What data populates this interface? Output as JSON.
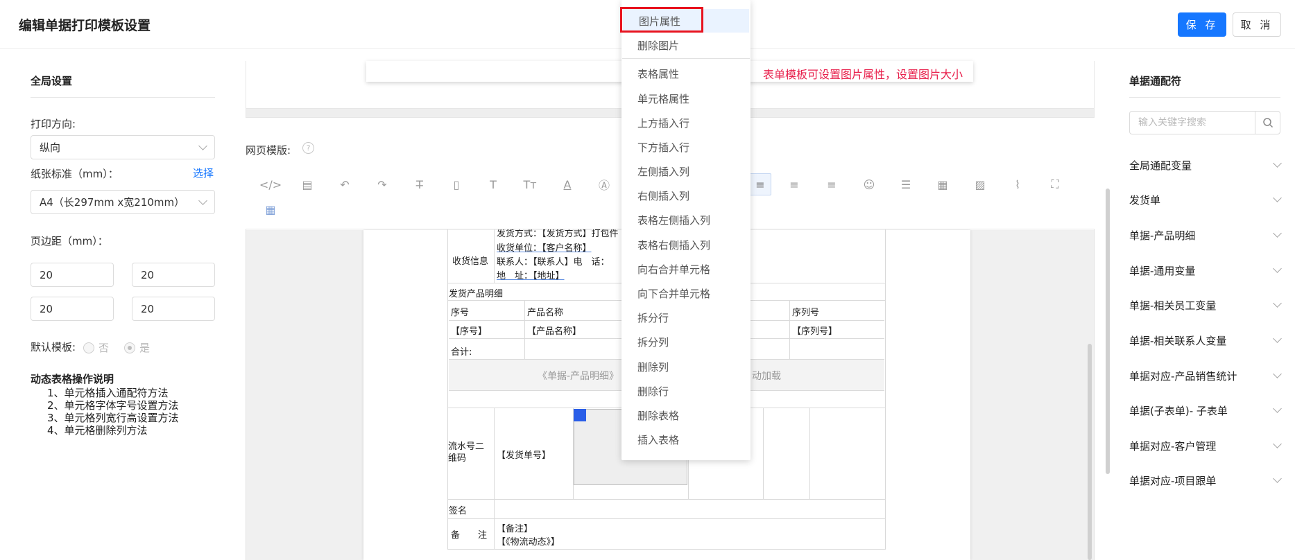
{
  "header": {
    "title": "编辑单据打印模板设置",
    "save_label": "保 存",
    "cancel_label": "取 消"
  },
  "global_settings": {
    "title": "全局设置",
    "orientation_label": "打印方向:",
    "orientation_value": "纵向",
    "paper_label": "纸张标准（mm）：",
    "paper_select_link": "选择",
    "paper_value": "A4（长297mm x宽210mm）",
    "margin_label": "页边距（mm）：",
    "margins": [
      "20",
      "20",
      "20",
      "20"
    ],
    "default_template_label": "默认模板:",
    "radio_no": "否",
    "radio_yes": "是",
    "default_template_value": "是"
  },
  "help": {
    "title": "动态表格操作说明",
    "items": [
      "1、单元格插入通配符方法",
      "2、单元格字体字号设置方法",
      "3、单元格列宽行高设置方法",
      "4、单元格删除列方法"
    ]
  },
  "center": {
    "annotation": "表单模板可设置图片属性，设置图片大小",
    "web_template_label": "网页模版:",
    "help_icon": "?"
  },
  "toolbar_icons": [
    "code-icon",
    "template-icon",
    "undo-icon",
    "redo-icon",
    "strikethrough-icon",
    "clear-format-icon",
    "font-icon",
    "font-size-icon",
    "font-color-icon",
    "bg-color-icon",
    "align-left-icon",
    "align-center-icon",
    "align-right-icon",
    "emoji-icon",
    "divider-icon",
    "table-icon",
    "image-icon",
    "attachment-icon",
    "fullscreen-icon",
    "table-grid-icon"
  ],
  "document": {
    "row1_label": "收货信息",
    "ship_method": "发货方式：【发货方式】打包件",
    "receiver_unit": "收货单位：【客户名称】",
    "contact": "联系人：【联系人】电　话：",
    "address": "地　址：【地址】",
    "product_section": "发货产品明细",
    "col_seq": "序号",
    "col_name": "产品名称",
    "col_serial": "序列号",
    "val_seq": "【序号】",
    "val_name": "【产品名称】",
    "val_serial": "【序列号】",
    "total": "合计:",
    "autoload_left": "《单据-产品明细》",
    "autoload_right": "自动加载",
    "qrcode_label": "流水号二维码",
    "order_no": "【发货单号】",
    "sign": "签名",
    "remark_label": "备　　注",
    "remark_value": "【备注】",
    "logistics": "【《物流动态》】"
  },
  "right_panel": {
    "title": "单据通配符",
    "search_placeholder": "输入关键字搜索",
    "items": [
      "全局通配变量",
      "发货单",
      "单据-产品明细",
      "单据-通用变量",
      "单据-相关员工变量",
      "单据-相关联系人变量",
      "单据对应-产品销售统计",
      "单据(子表单)- 子表单",
      "单据对应-客户管理",
      "单据对应-项目跟单"
    ]
  },
  "context_menu": {
    "items": [
      "图片属性",
      "删除图片",
      "表格属性",
      "单元格属性",
      "上方插入行",
      "下方插入行",
      "左侧插入列",
      "右侧插入列",
      "表格左侧插入列",
      "表格右侧插入列",
      "向右合并单元格",
      "向下合并单元格",
      "拆分行",
      "拆分列",
      "删除列",
      "删除行",
      "删除表格",
      "插入表格"
    ],
    "highlighted": "图片属性"
  },
  "colors": {
    "primary": "#1677ff",
    "annotation": "#e8204c",
    "highlight_box": "#e8131f"
  }
}
